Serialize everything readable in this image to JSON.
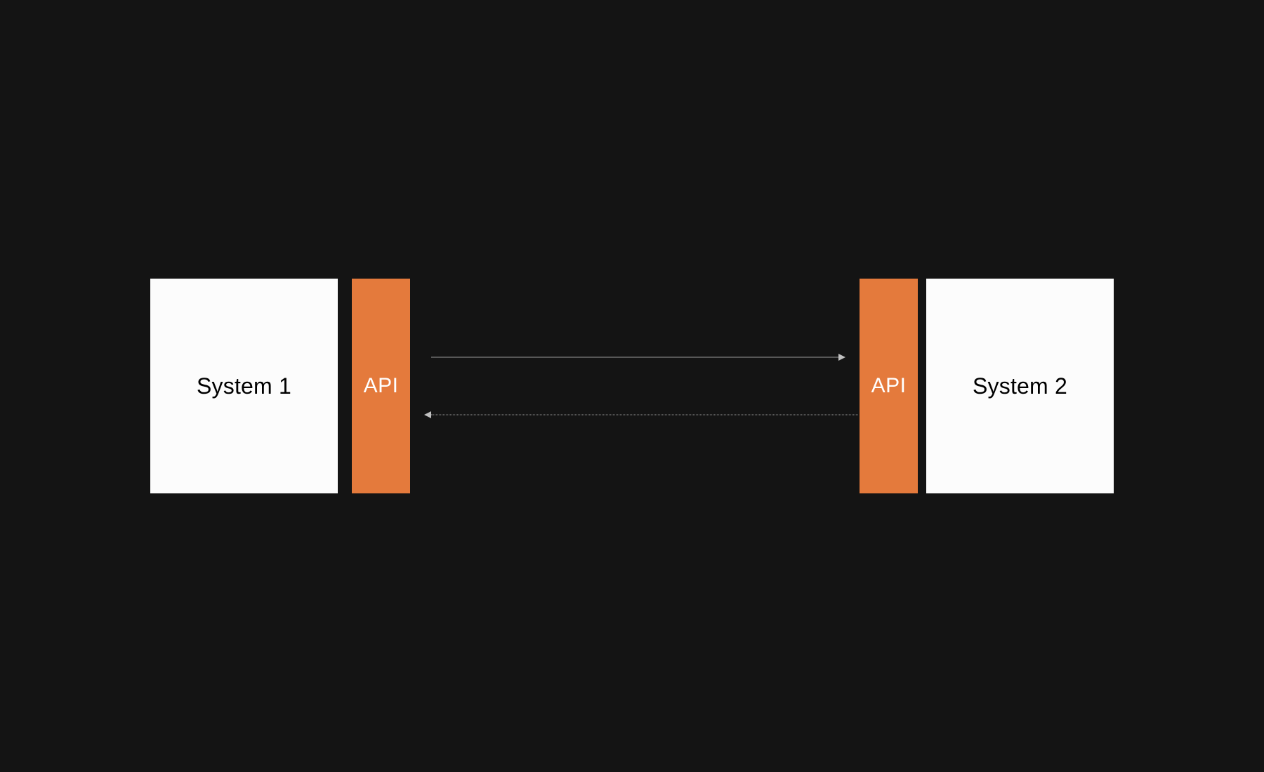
{
  "diagram": {
    "left_system": {
      "label": "System 1",
      "api_label": "API"
    },
    "right_system": {
      "label": "System 2",
      "api_label": "API"
    }
  },
  "colors": {
    "background": "#141414",
    "system_box": "#fcfcfc",
    "api_box": "#e47a3c",
    "arrow": "#9a9a9a"
  }
}
